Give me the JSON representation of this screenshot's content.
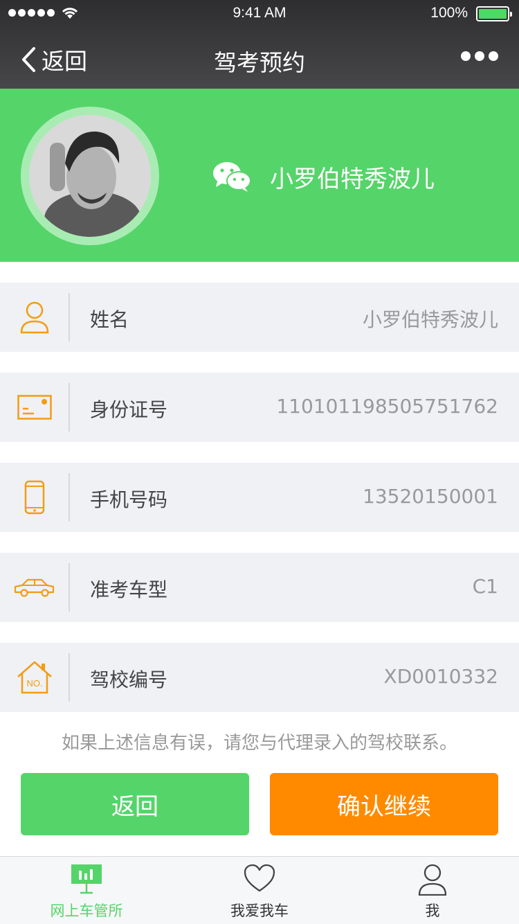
{
  "status_bar": {
    "time": "9:41 AM",
    "battery": "100%"
  },
  "nav": {
    "back_label": "返回",
    "title": "驾考预约"
  },
  "profile": {
    "nickname": "小罗伯特秀波儿"
  },
  "rows": [
    {
      "icon": "user-icon",
      "label": "姓名",
      "value": "小罗伯特秀波儿"
    },
    {
      "icon": "id-card-icon",
      "label": "身份证号",
      "value": "110101198505751762"
    },
    {
      "icon": "phone-icon",
      "label": "手机号码",
      "value": "13520150001"
    },
    {
      "icon": "car-icon",
      "label": "准考车型",
      "value": "C1"
    },
    {
      "icon": "school-house-icon",
      "label": "驾校编号",
      "value": "XD0010332"
    }
  ],
  "notice": "如果上述信息有误，请您与代理录入的驾校联系。",
  "buttons": {
    "back": "返回",
    "confirm": "确认继续"
  },
  "tabbar": {
    "items": [
      {
        "icon": "dmv-icon",
        "label": "网上车管所",
        "active": true
      },
      {
        "icon": "heart-icon",
        "label": "我爱我车",
        "active": false
      },
      {
        "icon": "person-icon",
        "label": "我",
        "active": false
      }
    ]
  },
  "colors": {
    "brand_green": "#55d46a",
    "accent_orange": "#ff8a00",
    "icon_orange": "#f39c12"
  }
}
